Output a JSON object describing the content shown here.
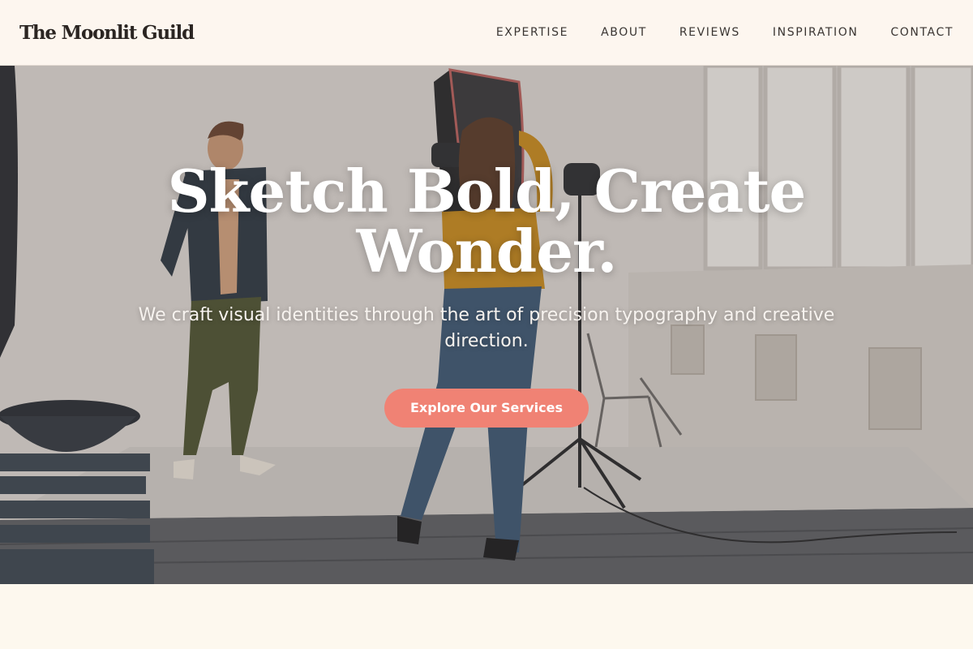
{
  "header": {
    "logo": "The Moonlit Guild",
    "nav": [
      {
        "label": "EXPERTISE"
      },
      {
        "label": "ABOUT"
      },
      {
        "label": "REVIEWS"
      },
      {
        "label": "INSPIRATION"
      },
      {
        "label": "CONTACT"
      }
    ]
  },
  "hero": {
    "title_line1": "Sketch Bold, Create",
    "title_line2": "Wonder.",
    "subtitle": "We craft visual identities through the art of precision typography and creative direction.",
    "cta_label": "Explore Our Services",
    "image": "photo-studio-shoot"
  },
  "colors": {
    "accent": "#f08274",
    "header_bg": "#fdf6ee",
    "page_bg": "#fdf8ee",
    "text_dark": "#2b2522"
  }
}
